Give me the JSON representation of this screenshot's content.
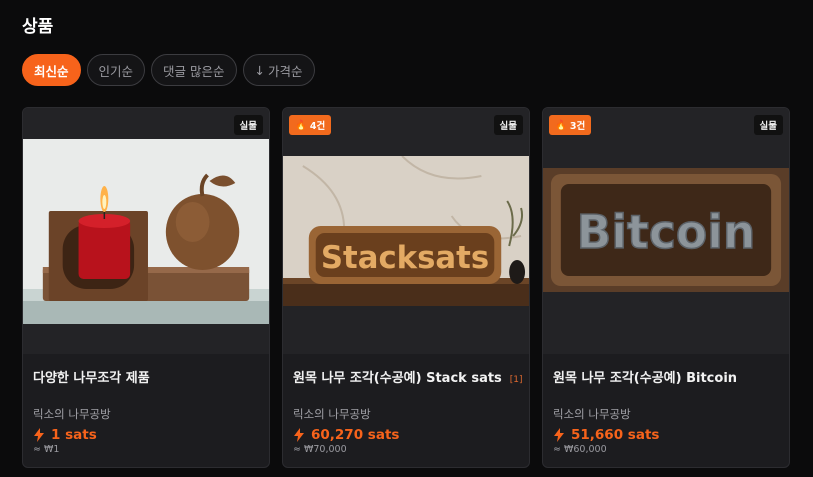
{
  "page": {
    "title": "상품"
  },
  "filters": [
    {
      "label": "최신순",
      "active": true
    },
    {
      "label": "인기순",
      "active": false
    },
    {
      "label": "댓글 많은순",
      "active": false
    },
    {
      "label": "가격순",
      "active": false,
      "icon": "arrow-down-icon"
    }
  ],
  "products": [
    {
      "count_badge": "",
      "type_badge": "실물",
      "name": "다양한 나무조각 제품",
      "name_count": "",
      "seller": "릭소의 나무공방",
      "price": "1 sats",
      "fiat": "≈ ₩1"
    },
    {
      "count_badge": "4건",
      "type_badge": "실물",
      "name": "원목 나무 조각(수공예) Stack sats",
      "name_count": "[1]",
      "seller": "릭소의 나무공방",
      "price": "60,270 sats",
      "fiat": "≈ ₩70,000",
      "image_text": "Stacksats"
    },
    {
      "count_badge": "3건",
      "type_badge": "실물",
      "name": "원목 나무 조각(수공예) Bitcoin",
      "name_count": "",
      "seller": "릭소의 나무공방",
      "price": "51,660 sats",
      "fiat": "≈ ₩60,000",
      "image_text": "Bitcoin"
    }
  ],
  "colors": {
    "accent": "#f7631b",
    "background": "#0b0b0c",
    "card": "#1c1c1f"
  }
}
